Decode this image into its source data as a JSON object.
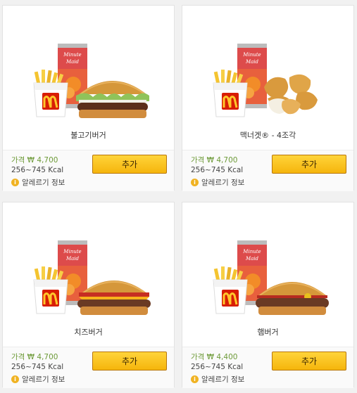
{
  "products": [
    {
      "name": "불고기버거",
      "price_label": "가격 ₩ 4,700",
      "kcal": "256~745 Kcal",
      "allergy": "알레르기 정보",
      "add": "추가"
    },
    {
      "name": "맥너겟® - 4조각",
      "price_label": "가격 ₩ 4,700",
      "kcal": "256~745 Kcal",
      "allergy": "알레르기 정보",
      "add": "추가"
    },
    {
      "name": "치즈버거",
      "price_label": "가격 ₩ 4,700",
      "kcal": "256~745 Kcal",
      "allergy": "알레르기 정보",
      "add": "추가"
    },
    {
      "name": "햄버거",
      "price_label": "가격 ₩ 4,400",
      "kcal": "256~745 Kcal",
      "allergy": "알레르기 정보",
      "add": "추가"
    }
  ],
  "drink_can_text": "Minute Maid",
  "allergy_icon_glyph": "i",
  "colors": {
    "add_button": "#f5b50c",
    "price_text": "#6d9a38",
    "mcd_red": "#d81e05",
    "mcd_gold": "#ffc72c"
  }
}
